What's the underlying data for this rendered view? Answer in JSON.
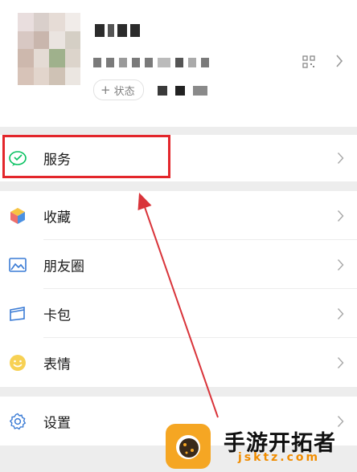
{
  "profile": {
    "status_label": "状态",
    "status_plus": "+"
  },
  "menu": {
    "service": {
      "label": "服务",
      "icon": "wechat-pay-icon"
    },
    "items": [
      {
        "label": "收藏",
        "icon": "cube-icon"
      },
      {
        "label": "朋友圈",
        "icon": "image-icon"
      },
      {
        "label": "卡包",
        "icon": "card-wallet-icon"
      },
      {
        "label": "表情",
        "icon": "smiley-icon"
      }
    ],
    "settings": {
      "label": "设置",
      "icon": "gear-icon"
    }
  },
  "annotation": {
    "highlight_color": "#e3262b"
  },
  "watermark": {
    "title": "手游开拓者",
    "url": "jsktz.com"
  },
  "colors": {
    "background": "#ededed",
    "panel": "#ffffff",
    "wechat_green": "#07c160",
    "watermark_orange": "#f5a623"
  }
}
